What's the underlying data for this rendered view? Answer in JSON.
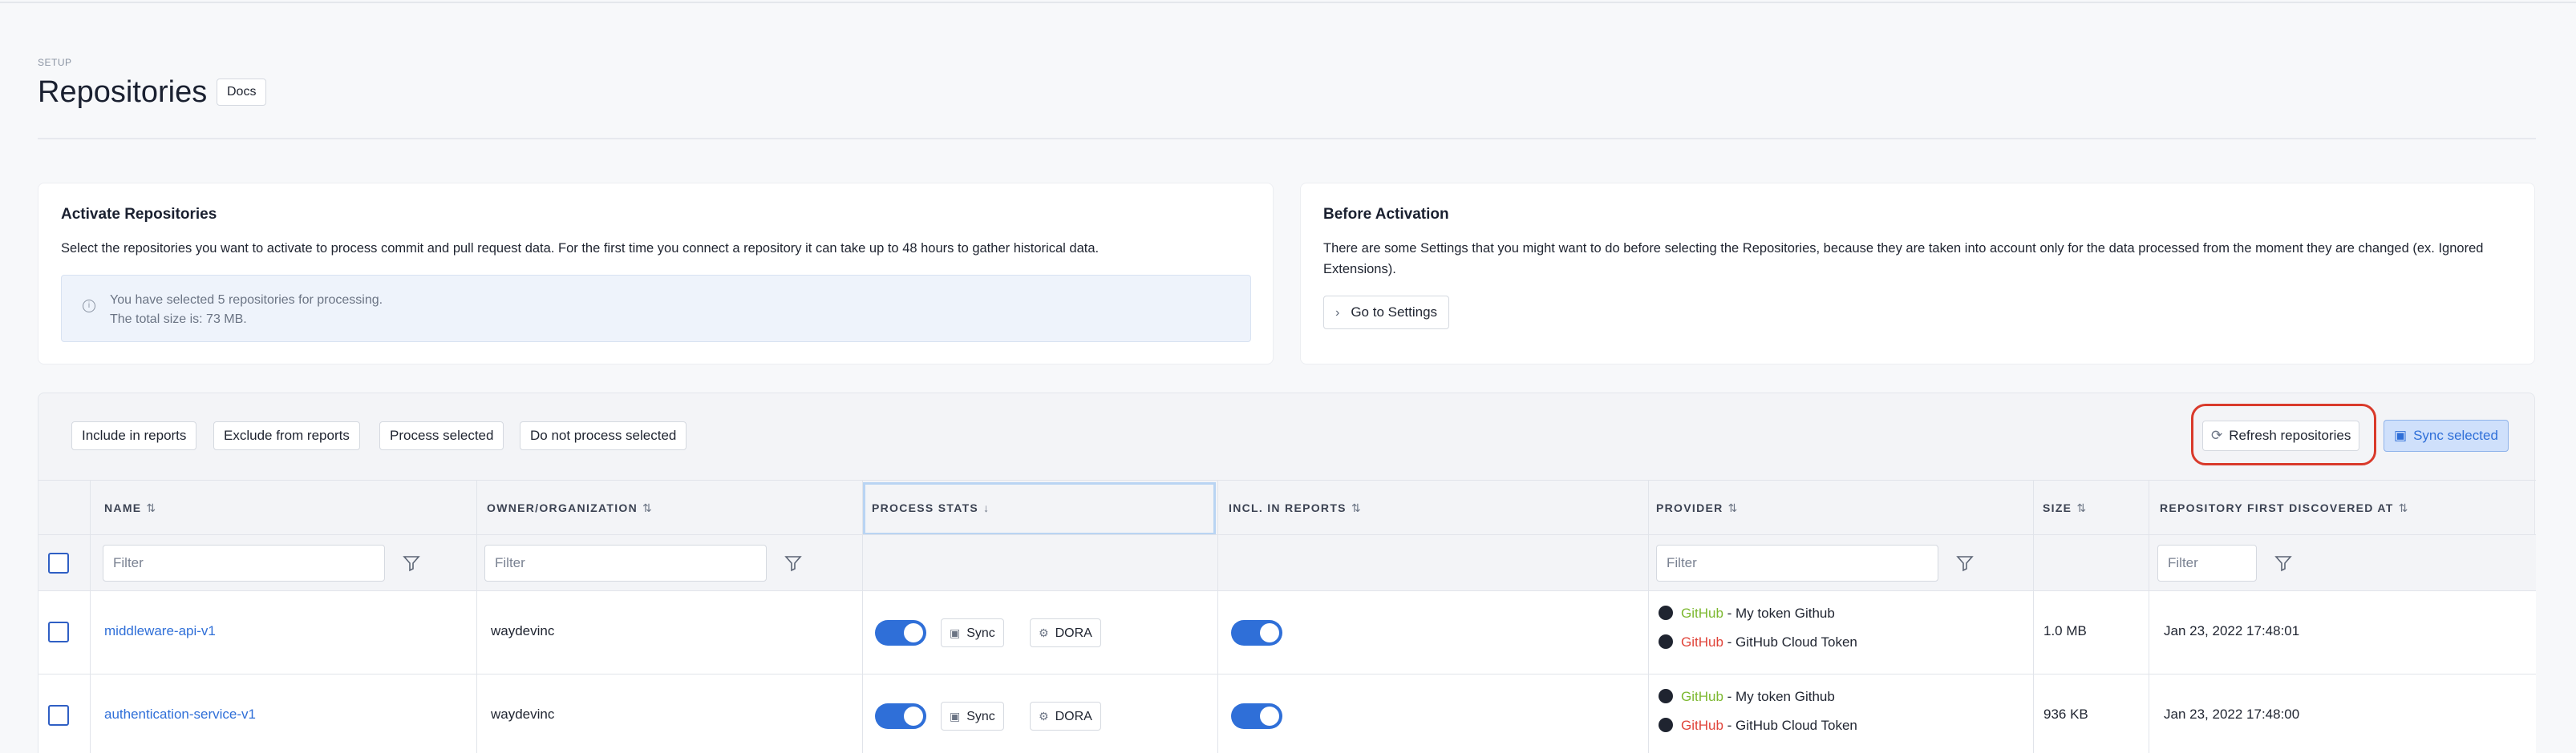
{
  "header": {
    "section": "SETUP",
    "title": "Repositories",
    "docs_label": "Docs"
  },
  "activate_card": {
    "title": "Activate Repositories",
    "description": "Select the repositories you want to activate to process commit and pull request data. For the first time you connect a repository it can take up to 48 hours to gather historical data.",
    "info_line1": "You have selected 5 repositories for processing.",
    "info_line2": "The total size is: 73 MB."
  },
  "before_card": {
    "title": "Before Activation",
    "description": "There are some Settings that you might want to do before selecting the Repositories, because they are taken into account only for the data processed from the moment they are changed (ex. Ignored Extensions).",
    "settings_label": "Go to Settings"
  },
  "toolbar": {
    "include_label": "Include in reports",
    "exclude_label": "Exclude from reports",
    "process_label": "Process selected",
    "no_process_label": "Do not process selected",
    "refresh_label": "Refresh repositories",
    "sync_selected_label": "Sync selected"
  },
  "columns": {
    "name": "NAME",
    "owner": "OWNER/ORGANIZATION",
    "process_stats": "PROCESS STATS",
    "incl_reports": "INCL. IN REPORTS",
    "provider": "PROVIDER",
    "size": "SIZE",
    "first_discovered": "REPOSITORY FIRST DISCOVERED AT"
  },
  "filters": {
    "placeholder": "Filter"
  },
  "rows": [
    {
      "name": "middleware-api-v1",
      "owner": "waydevinc",
      "sync_label": "Sync",
      "dora_label": "DORA",
      "provider1_name": "GitHub",
      "provider1_token": " - My token Github",
      "provider2_name": "GitHub",
      "provider2_token": " - GitHub Cloud Token",
      "size": "1.0 MB",
      "discovered": "Jan 23, 2022 17:48:01"
    },
    {
      "name": "authentication-service-v1",
      "owner": "waydevinc",
      "sync_label": "Sync",
      "dora_label": "DORA",
      "provider1_name": "GitHub",
      "provider1_token": " - My token Github",
      "provider2_name": "GitHub",
      "provider2_token": " - GitHub Cloud Token",
      "size": "936 KB",
      "discovered": "Jan 23, 2022 17:48:00"
    }
  ],
  "colors": {
    "accent": "#2f6fd8",
    "highlight_ring": "#d93a2b",
    "github_primary": "#7cb82f",
    "github_secondary": "#e0443a"
  },
  "icons": {
    "info": "info-icon",
    "chevron": "chevron-right-icon",
    "refresh": "refresh-icon",
    "save": "save-icon",
    "gear": "gear-icon",
    "funnel": "funnel-icon",
    "github": "github-icon"
  }
}
